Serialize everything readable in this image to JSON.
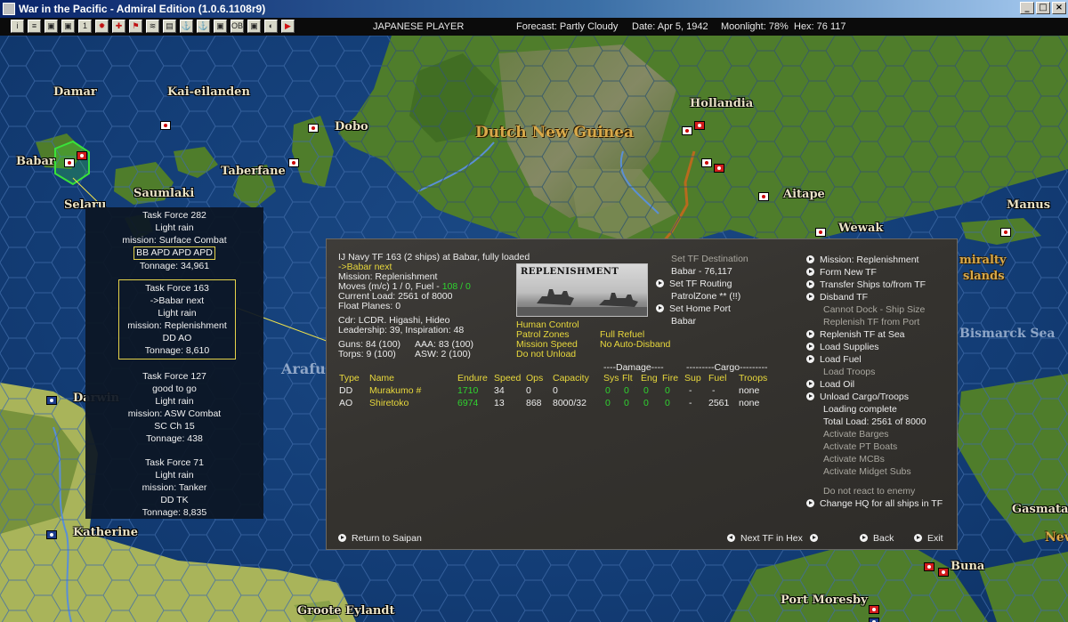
{
  "window": {
    "title": "War in the Pacific - Admiral Edition (1.0.6.1108r9)"
  },
  "toolbar": {
    "tools": [
      "i",
      "≡",
      "▣",
      "▣",
      "1",
      "✹",
      "✚",
      "⚑",
      "≋",
      "▤",
      "⚓",
      "⚓",
      "▣",
      "OB",
      "▣",
      "◐",
      "▶"
    ],
    "player": "JAPANESE PLAYER",
    "forecast": "Forecast: Partly Cloudy",
    "date": "Date: Apr 5, 1942",
    "moonlight": "Moonlight: 78%",
    "hex": "Hex: 76 117"
  },
  "map": {
    "places": {
      "damar": "Damar",
      "kai": "Kai-eilanden",
      "babar": "Babar",
      "dobo": "Dobo",
      "taberfane": "Taberfane",
      "saumlaki": "Saumlaki",
      "selaru": "Selaru",
      "hollandia": "Hollandia",
      "aitape": "Aitape",
      "wewak": "Wewak",
      "manus": "Manus",
      "admiralty1": "miralty",
      "admiralty2": "slands",
      "darwin": "Darwin",
      "katherine": "Katherine",
      "groote": "Groote Eylandt",
      "port_moresby": "Port Moresby",
      "buna": "Buna",
      "gasmata": "Gasmata",
      "new": "Nev"
    },
    "regions": {
      "dng": "Dutch New Guinea"
    },
    "seas": {
      "arafura": "Arafu",
      "bismarck": "Bismarck Sea"
    }
  },
  "tf_list": [
    {
      "title": "Task Force 282",
      "lines": [
        "Light rain",
        "mission: Surface Combat"
      ],
      "ships": "BB APD APD APD",
      "tonnage": "Tonnage: 34,961"
    },
    {
      "title": "Task Force 163",
      "lines": [
        "->Babar next",
        "Light rain",
        "mission: Replenishment",
        "DD AO"
      ],
      "tonnage": "Tonnage: 8,610"
    },
    {
      "title": "Task Force 127",
      "lines": [
        "good to go",
        "Light rain",
        "mission: ASW Combat",
        "SC Ch 15"
      ],
      "tonnage": "Tonnage: 438"
    },
    {
      "title": "Task Force 71",
      "lines": [
        "Light rain",
        "mission: Tanker",
        "DD TK"
      ],
      "tonnage": "Tonnage: 8,835"
    }
  ],
  "panel": {
    "header": "IJ Navy TF 163 (2 ships) at Babar, fully loaded",
    "next": "->Babar next",
    "mission": "Mission: Replenishment",
    "moves_prefix": "Moves (m/c)  1 / 0, Fuel - ",
    "fuel_value": "108 / 0",
    "current_load": "Current Load: 2561 of 8000",
    "float_planes": "Float Planes: 0",
    "cdr": "Cdr: LCDR. Higashi, Hideo",
    "leadership": "Leadership: 39, Inspiration: 48",
    "guns": "Guns: 84 (100)",
    "aaa": "AAA: 83 (100)",
    "torps": "Torps: 9 (100)",
    "asw": "ASW: 2 (100)",
    "photo_label": "REPLENISHMENT",
    "options_left": [
      "Human Control",
      "Patrol Zones",
      "Mission Speed",
      "Do not Unload"
    ],
    "options_right": [
      "Full Refuel",
      "No Auto-Disband"
    ],
    "dest": {
      "set_dest": "Set TF Destination",
      "dest_value": "Babar - 76,117",
      "set_routing": "Set TF Routing",
      "patrol_zone": "PatrolZone ** (!!)",
      "set_home": "Set Home Port",
      "home_value": "Babar"
    },
    "table": {
      "group_damage": "----Damage----",
      "group_cargo": "---------Cargo---------",
      "headers": [
        "Type",
        "Name",
        "Endure",
        "Speed",
        "Ops",
        "Capacity",
        "Sys",
        "Flt",
        "Eng",
        "Fire",
        "Sup",
        "Fuel",
        "Troops"
      ],
      "rows": [
        [
          "DD",
          "Murakumo #",
          "1710",
          "34",
          "0",
          "0",
          "0",
          "0",
          "0",
          "0",
          "-",
          "-",
          "none"
        ],
        [
          "AO",
          "Shiretoko",
          "6974",
          "13",
          "868",
          "8000/32",
          "0",
          "0",
          "0",
          "0",
          "-",
          "2561",
          "none"
        ]
      ]
    },
    "menu": [
      {
        "label": "Mission: Replenishment",
        "style": "active"
      },
      {
        "label": "Form New TF",
        "style": "active"
      },
      {
        "label": "Transfer Ships to/from TF",
        "style": "active"
      },
      {
        "label": "Disband TF",
        "style": "active"
      },
      {
        "label": "Cannot Dock - Ship Size",
        "style": "dim"
      },
      {
        "label": "Replenish TF from Port",
        "style": "dim"
      },
      {
        "label": "Replenish TF at Sea",
        "style": "active"
      },
      {
        "label": "Load Supplies",
        "style": "active"
      },
      {
        "label": "Load Fuel",
        "style": "active"
      },
      {
        "label": "Load Troops",
        "style": "dim"
      },
      {
        "label": "Load Oil",
        "style": "active"
      },
      {
        "label": "Unload Cargo/Troops",
        "style": "active"
      },
      {
        "label": "Loading complete",
        "style": "plain"
      },
      {
        "label": "Total Load: 2561 of 8000",
        "style": "plain"
      },
      {
        "label": "Activate Barges",
        "style": "dim"
      },
      {
        "label": "Activate PT Boats",
        "style": "dim"
      },
      {
        "label": "Activate MCBs",
        "style": "dim"
      },
      {
        "label": "Activate Midget Subs",
        "style": "dim"
      }
    ],
    "no_react": "Do not react to enemy",
    "change_hq": "Change HQ for all ships in TF",
    "bottom": {
      "return": "Return to Saipan",
      "next_tf": "Next TF in Hex",
      "back": "Back",
      "exit": "Exit"
    }
  },
  "colors": {
    "highlight_yellow": "#e8d83c",
    "value_green": "#2fd32f",
    "panel_bg": "#3a3835",
    "sea_blue": "#133d76",
    "land_green": "#4e7a2a"
  }
}
